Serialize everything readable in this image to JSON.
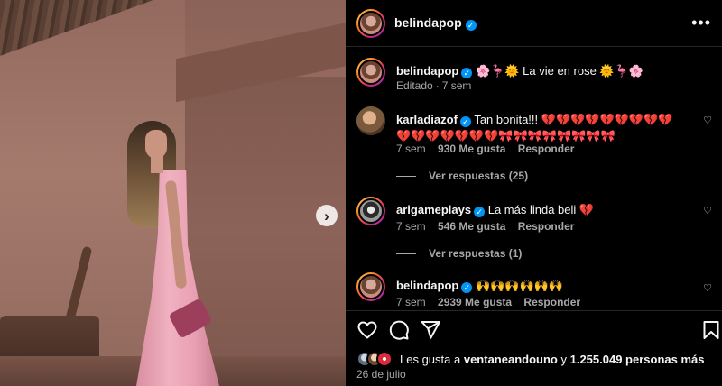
{
  "photo": {
    "next_icon": "chevron-right-icon"
  },
  "header": {
    "username": "belindapop",
    "more_icon": "more-horizontal-icon"
  },
  "caption": {
    "username": "belindapop",
    "text": "🌸🦩🌞 La vie en rose 🌞🦩🌸",
    "status": "Editado",
    "age": "7 sem"
  },
  "comments": [
    {
      "username": "karladiazof",
      "text": "Tan bonita!!! 💔💔💔💔💔💔💔💔💔💔💔💔💔💔💔💔🎀🎀🎀🎀🎀🎀🎀🎀",
      "age": "7 sem",
      "likes": "930 Me gusta",
      "reply_label": "Responder",
      "view_replies": "Ver respuestas (25)"
    },
    {
      "username": "arigameplays",
      "text": "La más linda beli 💔",
      "age": "7 sem",
      "likes": "546 Me gusta",
      "reply_label": "Responder",
      "view_replies": "Ver respuestas (1)"
    },
    {
      "username": "belindapop",
      "text": "🙌🙌🙌🙌🙌🙌",
      "age": "7 sem",
      "likes": "2939 Me gusta",
      "reply_label": "Responder"
    }
  ],
  "likes_summary": {
    "prefix": "Les gusta a",
    "user": "ventaneandouno",
    "connector": "y",
    "count": "1.255.049 personas más"
  },
  "date": "26 de julio",
  "colors": {
    "verified": "#0095f6",
    "secondary_text": "#a8a8a8",
    "divider": "#262626"
  }
}
